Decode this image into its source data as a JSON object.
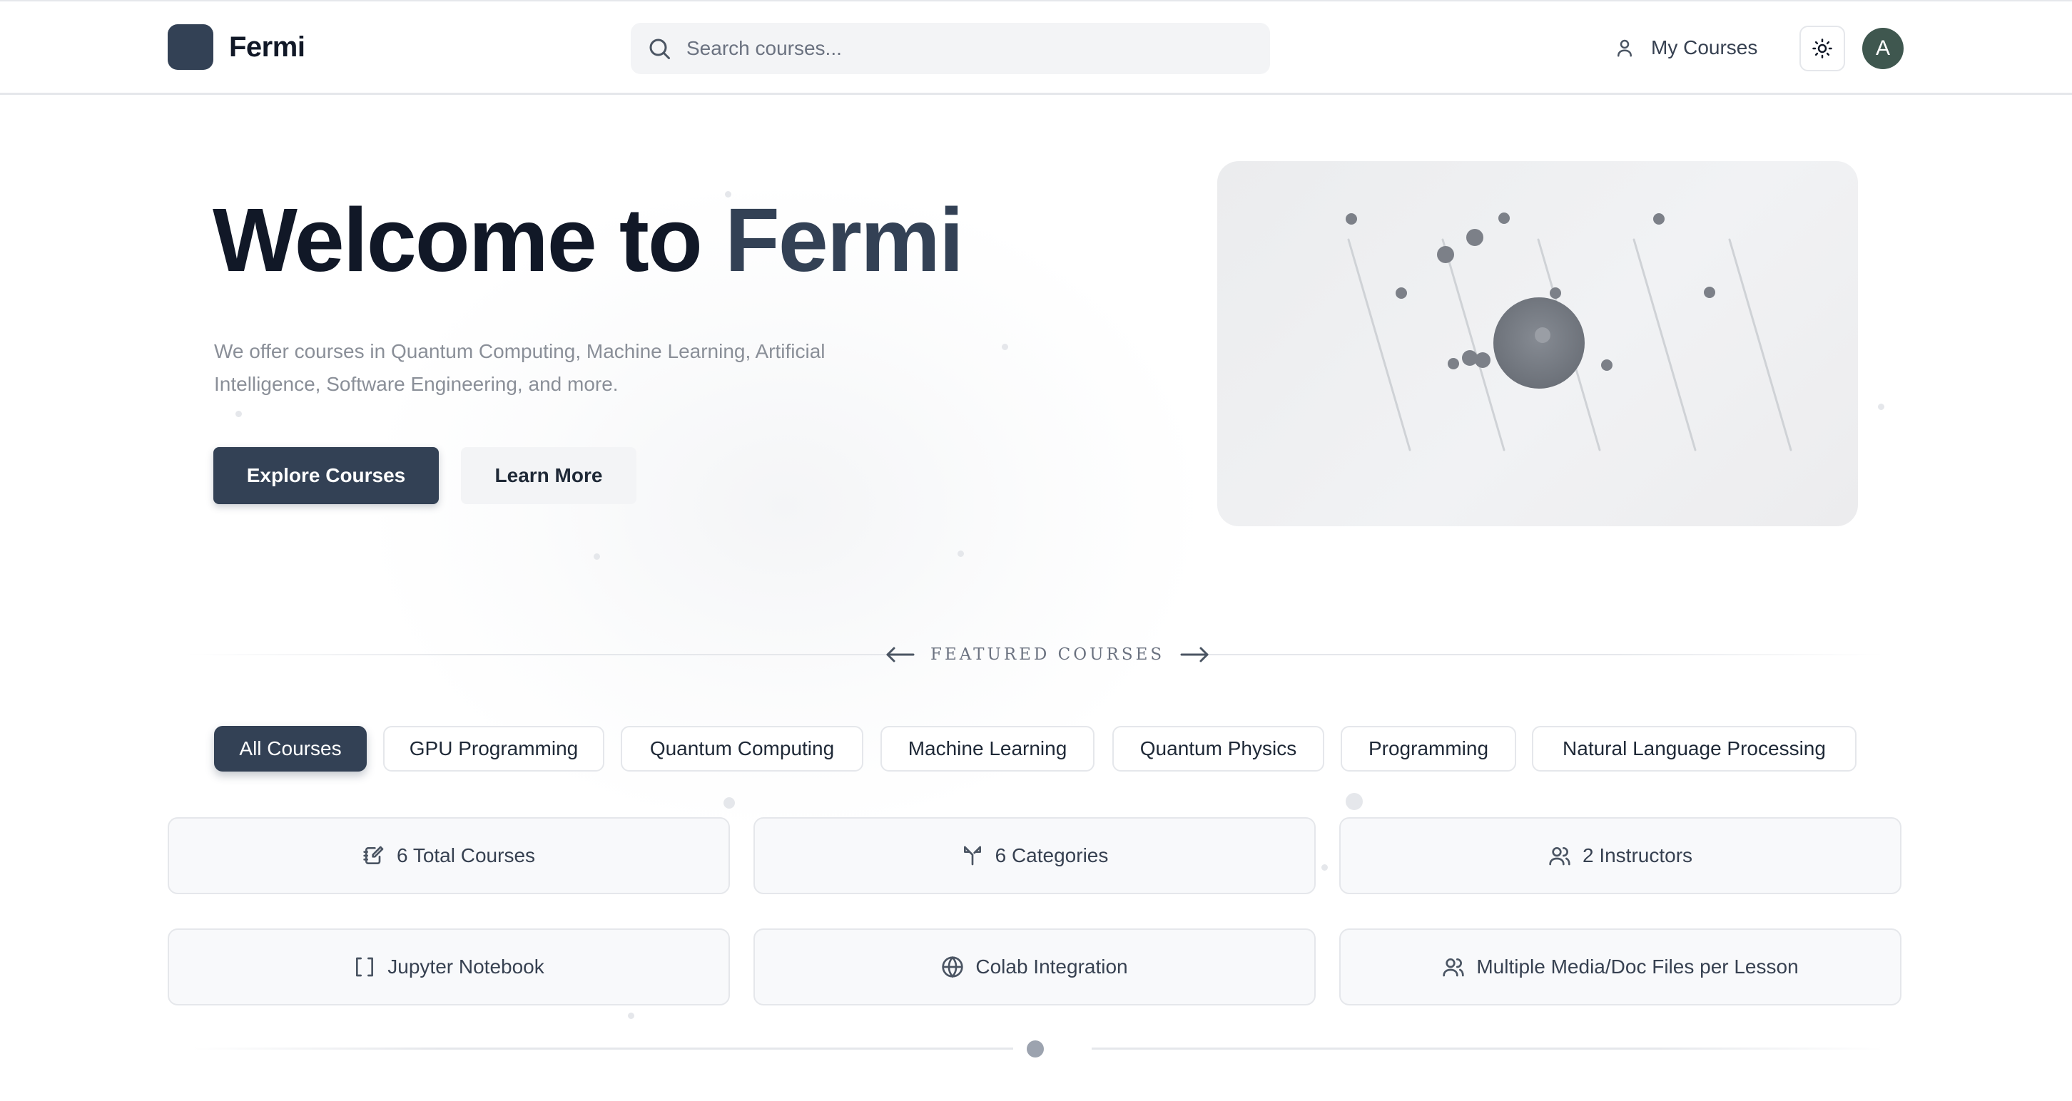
{
  "header": {
    "logo_text": "Fermi",
    "search_placeholder": "Search courses...",
    "my_courses_label": "My Courses",
    "avatar_initial": "A",
    "icons": {
      "search": "search-icon",
      "user": "user-icon",
      "theme": "sun-icon"
    }
  },
  "hero": {
    "title_prefix": "Welcome to ",
    "title_accent": "Fermi",
    "description": "We offer courses in Quantum Computing, Machine Learning, Artificial Intelligence, Software Engineering, and more.",
    "primary_button": "Explore Courses",
    "secondary_button": "Learn More",
    "illustration": "particle-orbit-illustration"
  },
  "featured": {
    "label": "FEATURED COURSES",
    "icons": {
      "prev": "arrow-left-icon",
      "next": "arrow-right-icon"
    }
  },
  "categories": {
    "selected": "All Courses",
    "items": [
      "All Courses",
      "GPU Programming",
      "Quantum Computing",
      "Machine Learning",
      "Quantum Physics",
      "Programming",
      "Natural Language Processing"
    ]
  },
  "stats": [
    {
      "label": "6 Total Courses",
      "icon": "notebook-pen-icon"
    },
    {
      "label": "6 Categories",
      "icon": "split-icon"
    },
    {
      "label": "2 Instructors",
      "icon": "users-icon"
    },
    {
      "label": "Jupyter Notebook",
      "icon": "brackets-icon"
    },
    {
      "label": "Colab Integration",
      "icon": "globe-icon"
    },
    {
      "label": "Multiple Media/Doc Files per Lesson",
      "icon": "users-icon"
    }
  ],
  "colors": {
    "primary": "#334155",
    "text_dark": "#111827",
    "muted_text": "#8a8f98",
    "border": "#e5e7eb",
    "avatar_bg": "#3f574f"
  }
}
